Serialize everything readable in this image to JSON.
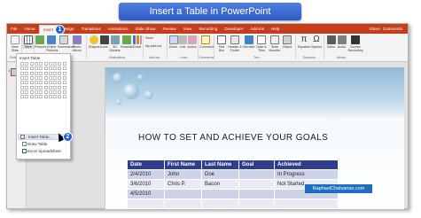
{
  "banner": {
    "title": "Insert a Table in PowerPoint"
  },
  "tabs": [
    "File",
    "Home",
    "Insert",
    "Design",
    "Transitions",
    "Animations",
    "Slide Show",
    "Review",
    "View",
    "Recording",
    "Developer",
    "Add-ins",
    "Help"
  ],
  "tabbar_right": {
    "share": "Share",
    "comments": "Comments"
  },
  "badges": {
    "step1": "1",
    "step2": "2"
  },
  "ribbon": {
    "buttons": [
      "New Slide",
      "Table",
      "Pictures",
      "Online Pictures",
      "Screenshot",
      "Photo Album",
      "Shapes",
      "Icons",
      "3D Models",
      "SmartArt",
      "Chart",
      "Store",
      "My Add-ins",
      "Zoom",
      "Link",
      "Action",
      "Comment",
      "Text Box",
      "Header & Footer",
      "WordArt",
      "Date & Time",
      "Slide Number",
      "Object",
      "Equation",
      "Symbol",
      "Video",
      "Audio",
      "Screen Recording"
    ],
    "groups": [
      "Slides",
      "Tables",
      "Images",
      "Illustrations",
      "Add-ins",
      "Links",
      "Comments",
      "Text",
      "Symbols",
      "Media"
    ]
  },
  "dropdown": {
    "header": "Insert Table",
    "items": [
      "Insert Table...",
      "Draw Table",
      "Excel Spreadsheet"
    ]
  },
  "thumbs": {
    "num": "1"
  },
  "slide": {
    "title": "HOW TO SET AND ACHIEVE YOUR GOALS",
    "table": {
      "headers": [
        "Date",
        "First Name",
        "Last Name",
        "Goal",
        "Achieved"
      ],
      "rows": [
        [
          "2/4/2010",
          "John",
          "Doe",
          "",
          "In Progress"
        ],
        [
          "3/6/2010",
          "Chris P.",
          "Bacon",
          "",
          "Not Started"
        ],
        [
          "4/5/2010",
          "",
          "",
          "",
          ""
        ],
        [
          "",
          "",
          "",
          "",
          ""
        ]
      ]
    },
    "footer": "RaphaelChalvarian.com"
  },
  "colors": {
    "accent": "#c43e1c",
    "table_header": "#2e3d8f",
    "banner": "#3a6ad4"
  }
}
